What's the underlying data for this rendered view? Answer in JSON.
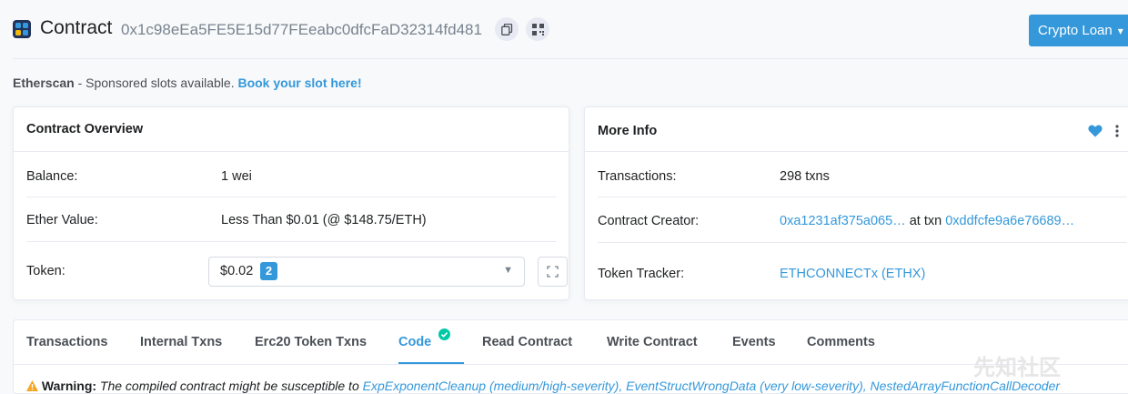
{
  "header": {
    "title": "Contract",
    "address": "0x1c98eEa5FE5E15d77FEeabc0dfcFaD32314fd481",
    "crypto_button": "Crypto Loan"
  },
  "sponsor": {
    "brand": "Etherscan",
    "text": " - Sponsored slots available. ",
    "link": "Book your slot here!"
  },
  "overview": {
    "title": "Contract Overview",
    "balance_label": "Balance:",
    "balance_value": "1 wei",
    "ether_label": "Ether Value:",
    "ether_value": "Less Than $0.01 (@ $148.75/ETH)",
    "token_label": "Token:",
    "token_value": "$0.02",
    "token_count": "2"
  },
  "more_info": {
    "title": "More Info",
    "tx_label": "Transactions:",
    "tx_value": "298 txns",
    "creator_label": "Contract Creator:",
    "creator_address": "0xa1231af375a065…",
    "creator_at": " at txn ",
    "creator_txn": "0xddfcfe9a6e76689…",
    "tracker_label": "Token Tracker:",
    "tracker_value": "ETHCONNECTx (ETHX)"
  },
  "tabs": [
    "Transactions",
    "Internal Txns",
    "Erc20 Token Txns",
    "Code",
    "Read Contract",
    "Write Contract",
    "Events",
    "Comments"
  ],
  "active_tab": "Code",
  "warning": {
    "label": "Warning:",
    "text": " The compiled contract might be susceptible to ",
    "links": "ExpExponentCleanup (medium/high-severity), EventStructWrongData (very low-severity), NestedArrayFunctionCallDecoder"
  },
  "watermark": "先知社区",
  "colors": {
    "accent": "#3498db",
    "success": "#00c9a7",
    "text": "#1e2022",
    "muted": "#77838f"
  },
  "icons": [
    "contract-logo-icon",
    "copy-icon",
    "qr-code-icon",
    "chevron-down-icon",
    "heart-icon",
    "kebab-menu-icon",
    "expand-icon",
    "check-circle-icon",
    "warning-icon"
  ]
}
